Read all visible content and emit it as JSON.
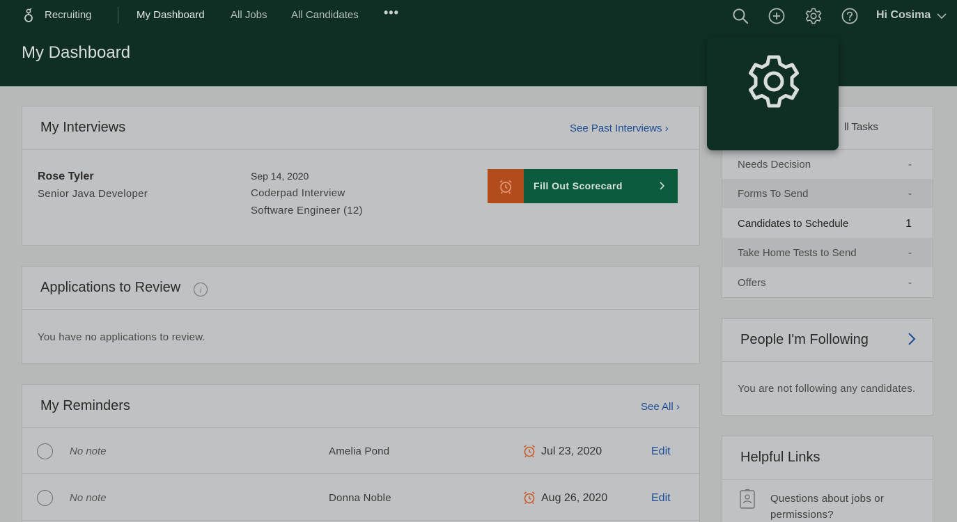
{
  "topnav": {
    "brand": "Recruiting",
    "links": [
      "My Dashboard",
      "All Jobs",
      "All Candidates"
    ],
    "more": "•••",
    "greeting": "Hi Cosima"
  },
  "page": {
    "title": "My Dashboard"
  },
  "interviews": {
    "title": "My Interviews",
    "past_link": "See Past Interviews ›",
    "item": {
      "candidate": "Rose Tyler",
      "role": "Senior Java Developer",
      "date": "Sep 14, 2020",
      "type": "Coderpad Interview",
      "job": "Software Engineer (12)"
    },
    "scorecard_label": "Fill Out Scorecard"
  },
  "applications": {
    "title": "Applications to Review",
    "empty": "You have no applications to review."
  },
  "reminders": {
    "title": "My Reminders",
    "see_all": "See All ›",
    "rows": [
      {
        "note": "No note",
        "candidate": "Amelia Pond",
        "date": "Jul 23, 2020",
        "edit": "Edit"
      },
      {
        "note": "No note",
        "candidate": "Donna Noble",
        "date": "Aug 26, 2020",
        "edit": "Edit"
      }
    ]
  },
  "tasks": {
    "header_partial": "ll Tasks",
    "rows": [
      {
        "label": "Needs Decision",
        "count": "-"
      },
      {
        "label": "Forms To Send",
        "count": "-"
      },
      {
        "label": "Candidates to Schedule",
        "count": "1"
      },
      {
        "label": "Take Home Tests to Send",
        "count": "-"
      },
      {
        "label": "Offers",
        "count": "-"
      }
    ]
  },
  "following": {
    "title": "People I'm Following",
    "empty": "You are not following any candidates."
  },
  "helpful": {
    "title": "Helpful Links",
    "link": "Questions about jobs or permissions?"
  },
  "colors": {
    "nav_bg": "#0f2e24",
    "accent_green": "#0d5b3d",
    "accent_orange": "#b24c1c",
    "link_blue": "#1d4c96",
    "page_bg": "#b7b9b9"
  },
  "icons": [
    "search-icon",
    "add-circle-icon",
    "gear-icon",
    "help-circle-icon",
    "chevron-down-icon",
    "alarm-icon",
    "info-icon",
    "document-icon",
    "chevron-right-icon"
  ]
}
